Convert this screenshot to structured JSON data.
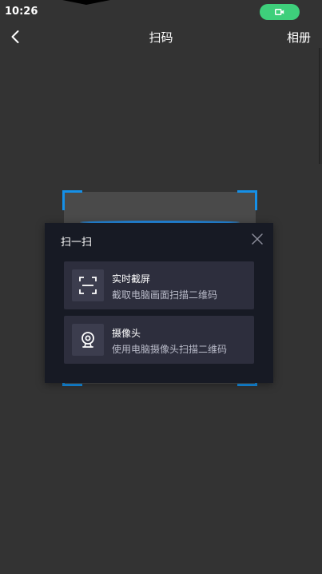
{
  "status_bar": {
    "time": "10:26"
  },
  "nav": {
    "title": "扫码",
    "album_label": "相册"
  },
  "dialog": {
    "title": "扫一扫",
    "options": [
      {
        "icon": "screenshot-scan-icon",
        "title": "实时截屏",
        "subtitle": "截取电脑画面扫描二维码"
      },
      {
        "icon": "camera-icon",
        "title": "摄像头",
        "subtitle": "使用电脑摄像头扫描二维码"
      }
    ]
  },
  "colors": {
    "background": "#333333",
    "accent_blue": "#1590e8",
    "record_green": "#3ecf7b",
    "dialog_bg": "#171a24",
    "option_bg": "#2d2e3d"
  }
}
